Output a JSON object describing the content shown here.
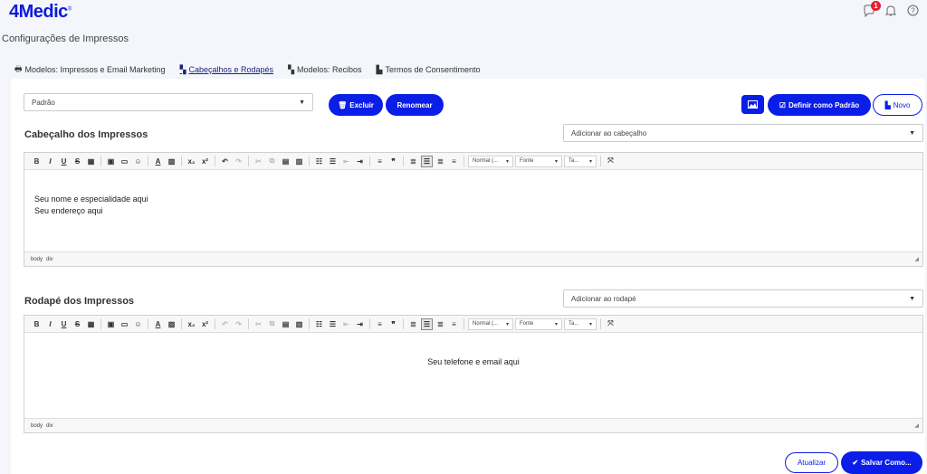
{
  "header": {
    "logo_prefix": "4",
    "logo_text": "Medic",
    "logo_reg": "®",
    "notification_count": "1",
    "icons": [
      "chat-icon",
      "bell-icon",
      "help-icon"
    ]
  },
  "page": {
    "title": "Configurações de Impressos"
  },
  "tabs": [
    {
      "label": "Modelos: Impressos e Email Marketing",
      "icon": "printer-icon",
      "active": false
    },
    {
      "label": "Cabeçalhos e Rodapés",
      "icon": "files-icon",
      "active": true
    },
    {
      "label": "Modelos: Recibos",
      "icon": "files-icon",
      "active": false
    },
    {
      "label": "Termos de Consentimento",
      "icon": "document-icon",
      "active": false
    }
  ],
  "template_select": {
    "value": "Padrão"
  },
  "buttons": {
    "delete": "Excluir",
    "rename": "Renomear",
    "set_default": "Definir como Padrão",
    "new": "Novo",
    "update": "Atualizar",
    "save_as": "Salvar Como..."
  },
  "header_section": {
    "title": "Cabeçalho dos Impressos",
    "add_select": "Adicionar ao cabeçalho",
    "content_lines": [
      "Seu nome e especialidade aqui",
      "Seu endereço aqui"
    ],
    "status_path": [
      "body",
      "div"
    ]
  },
  "footer_section": {
    "title": "Rodapé dos Impressos",
    "add_select": "Adicionar ao rodapé",
    "content_lines": [
      "Seu telefone e email aqui"
    ],
    "status_path": [
      "body",
      "div"
    ]
  },
  "toolbar": {
    "format_combo": "Normal (...",
    "font_combo": "Fonte",
    "size_combo": "Ta..."
  },
  "colors": {
    "primary": "#0a1ee8",
    "background": "#f4f6fb",
    "badge": "#e0202a"
  }
}
